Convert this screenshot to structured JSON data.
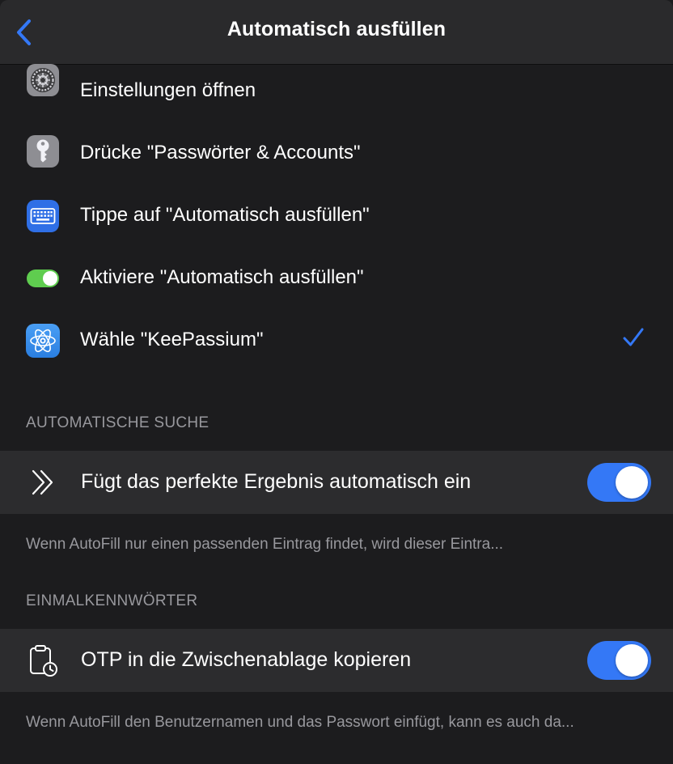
{
  "navbar": {
    "title": "Automatisch ausfüllen"
  },
  "steps": [
    {
      "label": "Einstellungen öffnen",
      "icon": "settings-gear-icon"
    },
    {
      "label": "Drücke \"Passwörter & Accounts\"",
      "icon": "key-icon"
    },
    {
      "label": "Tippe auf \"Automatisch ausfüllen\"",
      "icon": "keyboard-icon"
    },
    {
      "label": "Aktiviere \"Automatisch ausfüllen\"",
      "icon": "toggle-switch-icon"
    },
    {
      "label": "Wähle \"KeePassium\"",
      "icon": "keepassium-app-icon",
      "selected": true
    }
  ],
  "auto_search": {
    "header": "AUTOMATISCHE SUCHE",
    "cell_label": "Fügt das perfekte Ergebnis automatisch ein",
    "icon": "double-chevron-right-icon",
    "enabled": true,
    "footer": "Wenn AutoFill nur einen passenden Eintrag findet, wird dieser Eintra..."
  },
  "otp": {
    "header": "EINMALKENNWÖRTER",
    "cell_label": "OTP in die Zwischenablage kopieren",
    "icon": "clipboard-clock-icon",
    "enabled": true,
    "footer": "Wenn AutoFill den Benutzernamen und das Passwort einfügt, kann es auch da..."
  },
  "colors": {
    "accent": "#3478f6",
    "background": "#1c1c1e",
    "cell_background": "#2c2c2e",
    "secondary_text": "#98989d",
    "toggle_green": "#5fcd4f"
  }
}
